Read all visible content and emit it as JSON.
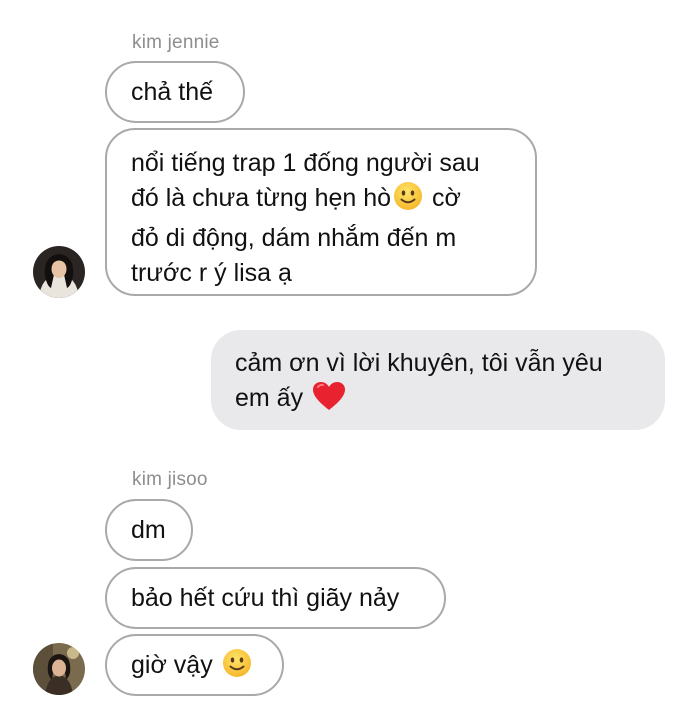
{
  "conversation": {
    "group1": {
      "sender": "kim jennie",
      "messages": [
        {
          "text": "chả thế"
        },
        {
          "text_parts": [
            "nổi tiếng trap 1 đống người sau",
            "đó là chưa từng hẹn hò",
            " cờ",
            "đỏ di động, dám nhắm đến m",
            "trước r ý lisa ạ"
          ],
          "emoji": "slightly-smiling-face-icon"
        }
      ],
      "avatar": "avatar-kim-jennie"
    },
    "outgoing": {
      "text_parts": [
        "cảm ơn vì lời khuyên, tôi vẫn yêu",
        "em ấy "
      ],
      "emoji": "red-heart-icon"
    },
    "group2": {
      "sender": "kim jisoo",
      "messages": [
        {
          "text": "dm"
        },
        {
          "text": "bảo hết cứu thì giãy nảy"
        },
        {
          "text": "giờ vậy ",
          "emoji": "slightly-smiling-face-icon"
        }
      ],
      "avatar": "avatar-kim-jisoo"
    }
  },
  "colors": {
    "incoming_border": "#a9a9a9",
    "outgoing_bg": "#e9e9ec",
    "sender_name": "#8e8e8e",
    "text": "#111111"
  }
}
